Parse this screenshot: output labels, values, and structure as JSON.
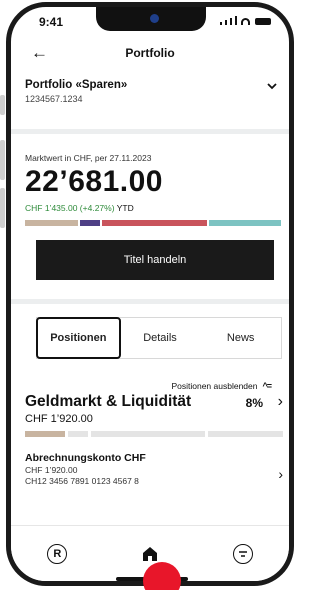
{
  "status": {
    "time": "9:41"
  },
  "nav": {
    "title": "Portfolio",
    "back_icon": "arrow-left-icon"
  },
  "portfolio": {
    "name": "Portfolio «Sparen»",
    "number": "1234567.1234",
    "value_label": "Marktwert in CHF, per 27.11.2023",
    "value": "22’681.00",
    "ytd_change": "CHF 1’435.00 (+4.27%)",
    "ytd_label": "YTD",
    "allocation": [
      {
        "color": "#c8b4a0",
        "share": 0.21
      },
      {
        "color": "#4e3f85",
        "share": 0.08
      },
      {
        "color": "#c9545c",
        "share": 0.42
      },
      {
        "color": "#7dc3c2",
        "share": 0.29
      }
    ]
  },
  "actions": {
    "trade_label": "Titel handeln"
  },
  "tabs": [
    {
      "label": "Positionen",
      "active": true
    },
    {
      "label": "Details",
      "active": false
    },
    {
      "label": "News",
      "active": false
    }
  ],
  "positions": {
    "hide_label": "Positionen ausblenden",
    "category": {
      "title": "Geldmarkt & Liquidität",
      "percent": "8%",
      "amount": "CHF 1’920.00",
      "bar": [
        {
          "color": "#c8b4a0",
          "share": 0.16
        },
        {
          "color": "#e4e4e4",
          "share": 0.08
        },
        {
          "color": "#e4e4e4",
          "share": 0.46
        },
        {
          "color": "#e4e4e4",
          "share": 0.3
        }
      ]
    },
    "items": [
      {
        "name": "Abrechnungskonto CHF",
        "amount": "CHF 1’920.00",
        "iban": "CH12 3456 7891 0123 4567 8"
      }
    ]
  },
  "bottom_nav": [
    {
      "icon": "registered-r-icon",
      "glyph": "R"
    },
    {
      "icon": "home-icon"
    },
    {
      "icon": "chat-icon"
    }
  ],
  "colors": {
    "positive": "#2e8b3a",
    "brand_red": "#e8162a",
    "dark": "#1a1a1a"
  }
}
